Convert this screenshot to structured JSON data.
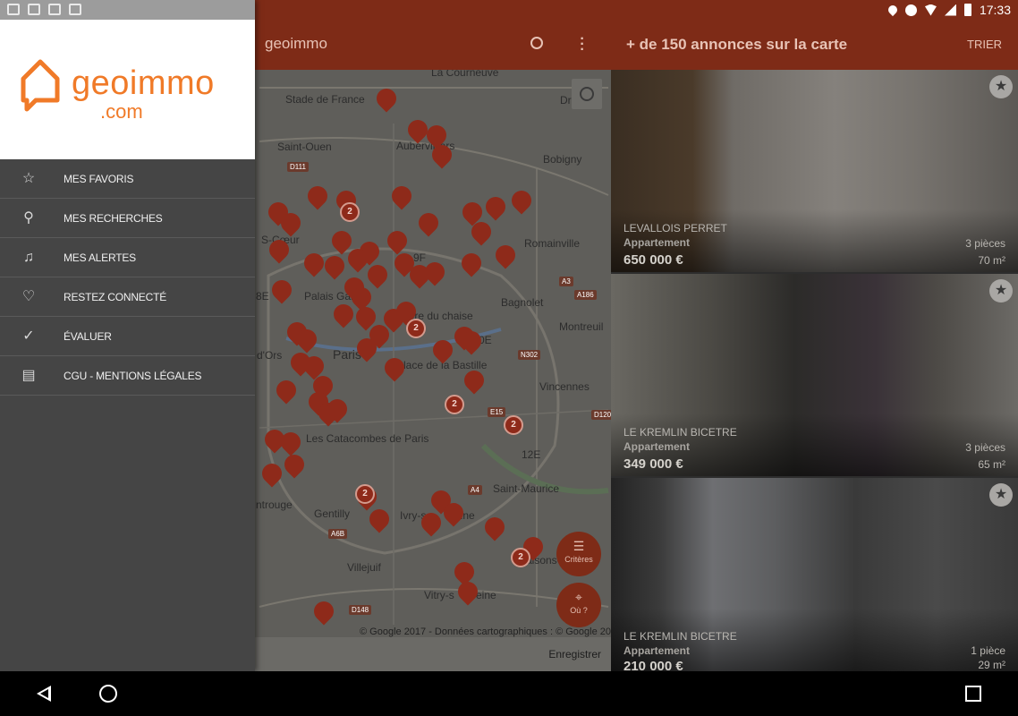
{
  "status_bar": {
    "time": "17:33"
  },
  "map_appbar": {
    "brand": "geoimmo"
  },
  "list_appbar": {
    "title": "+ de 150 annonces sur la carte",
    "sort_label": "TRIER"
  },
  "map": {
    "labels": [
      {
        "text": "La Courneuve"
      },
      {
        "text": "Stade de France"
      },
      {
        "text": "Aubervilliers"
      },
      {
        "text": "Dr"
      },
      {
        "text": "Saint-Ouen"
      },
      {
        "text": "Bobigny"
      },
      {
        "text": "S-Cœur"
      },
      {
        "text": "Romainville"
      },
      {
        "text": "Palais Garn"
      },
      {
        "text": "Bagnolet"
      },
      {
        "text": "8E"
      },
      {
        "text": "9F"
      },
      {
        "text": "étière du chaise"
      },
      {
        "text": "Montreuil"
      },
      {
        "text": "d'Ors"
      },
      {
        "text": "Paris"
      },
      {
        "text": "Place de la Bastille"
      },
      {
        "text": "Vincennes"
      },
      {
        "text": "0E"
      },
      {
        "text": "Les Catacombes de Paris"
      },
      {
        "text": "12E"
      },
      {
        "text": "Saint-Maurice"
      },
      {
        "text": "ntrouge"
      },
      {
        "text": "Gentilly"
      },
      {
        "text": "Ivry-s"
      },
      {
        "text": "eine"
      },
      {
        "text": "Maisons-Alf"
      },
      {
        "text": "Villejuif"
      },
      {
        "text": "Vitry-s"
      },
      {
        "text": "eine"
      }
    ],
    "road_badges": [
      "D111",
      "A3",
      "A186",
      "N302",
      "E15",
      "D120",
      "A4",
      "A6B",
      "D148"
    ],
    "clusters": [
      "2",
      "2",
      "2",
      "2",
      "2",
      "2"
    ],
    "copyright": "© Google 2017 - Données cartographiques : © Google 2017",
    "fab_criteria": "Critères",
    "fab_where": "Où ?",
    "save_label": "Enregistrer"
  },
  "listings": [
    {
      "city": "LEVALLOIS PERRET",
      "type": "Appartement",
      "price": "650 000 €",
      "rooms": "3 pièces",
      "area": "70 m²"
    },
    {
      "city": "LE KREMLIN BICETRE",
      "type": "Appartement",
      "price": "349 000 €",
      "rooms": "3 pièces",
      "area": "65 m²"
    },
    {
      "city": "LE KREMLIN BICETRE",
      "type": "Appartement",
      "price": "210 000 €",
      "rooms": "1 pièce",
      "area": "29 m²"
    }
  ],
  "drawer": {
    "logo_text": "geoimmo",
    "logo_sub": ".com",
    "items": [
      {
        "label": "MES FAVORIS",
        "icon": "star-icon"
      },
      {
        "label": "MES RECHERCHES",
        "icon": "search-heart-icon"
      },
      {
        "label": "MES ALERTES",
        "icon": "bell-icon"
      },
      {
        "label": "RESTEZ CONNECTÉ",
        "icon": "handshake-icon"
      },
      {
        "label": "ÉVALUER",
        "icon": "thumbs-up-icon"
      },
      {
        "label": "CGU - MENTIONS LÉGALES",
        "icon": "clipboard-icon"
      }
    ]
  },
  "colors": {
    "app_bar": "#7e2b17",
    "pin": "#8e2a1a",
    "logo_orange": "#f07a28",
    "drawer_bg": "#454545"
  }
}
